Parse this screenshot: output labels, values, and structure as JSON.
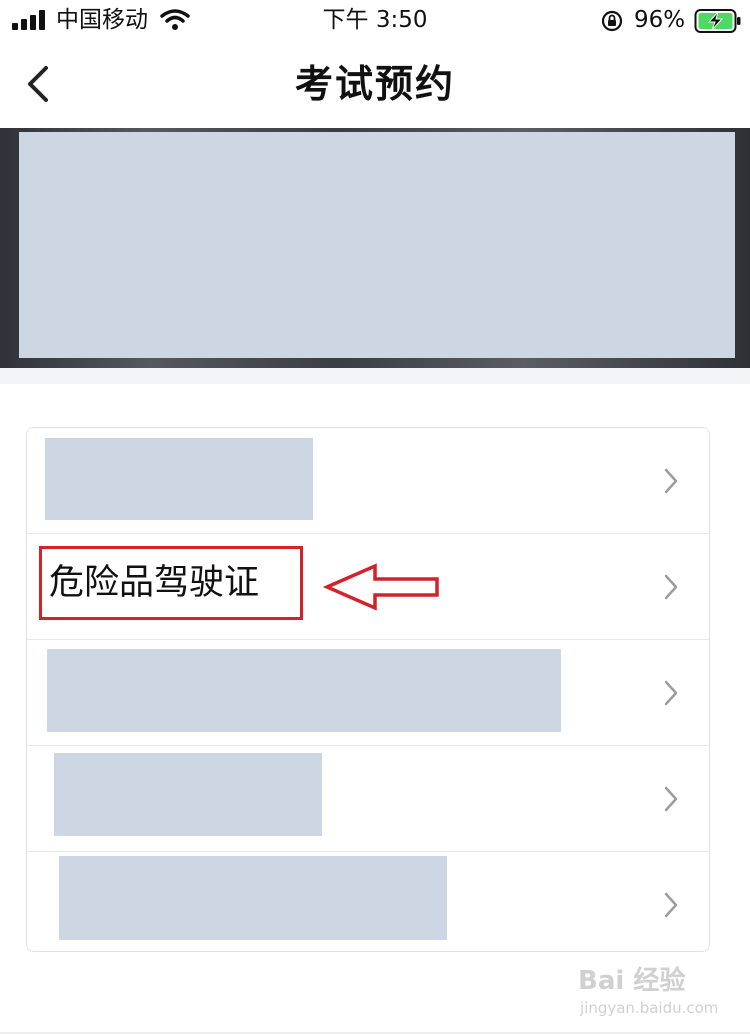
{
  "status_bar": {
    "carrier": "中国移动",
    "time": "下午 3:50",
    "battery_percent": "96%",
    "icons": [
      "signal-icon",
      "wifi-icon",
      "lock-rotation-icon",
      "battery-charging-icon"
    ]
  },
  "nav": {
    "title": "考试预约",
    "back_icon": "chevron-left-icon"
  },
  "banner": {
    "content": "redacted"
  },
  "list": {
    "items": [
      {
        "label": "",
        "redacted": true,
        "icon": "chevron-right-icon"
      },
      {
        "label": "危险品驾驶证",
        "redacted": false,
        "highlighted": true,
        "icon": "chevron-right-icon"
      },
      {
        "label": "",
        "redacted": true,
        "icon": "chevron-right-icon"
      },
      {
        "label": "",
        "redacted": true,
        "icon": "chevron-right-icon"
      },
      {
        "label": "",
        "redacted": true,
        "icon": "chevron-right-icon"
      }
    ]
  },
  "annotation": {
    "highlight_color": "#d4222a",
    "arrow_icon": "arrow-left-outline-icon"
  },
  "watermark": {
    "logo": "Bai 经验",
    "url": "jingyan.baidu.com"
  },
  "colors": {
    "redaction": "#cdd7e3",
    "divider": "#e6e8ec",
    "annotation_red": "#d4222a"
  }
}
